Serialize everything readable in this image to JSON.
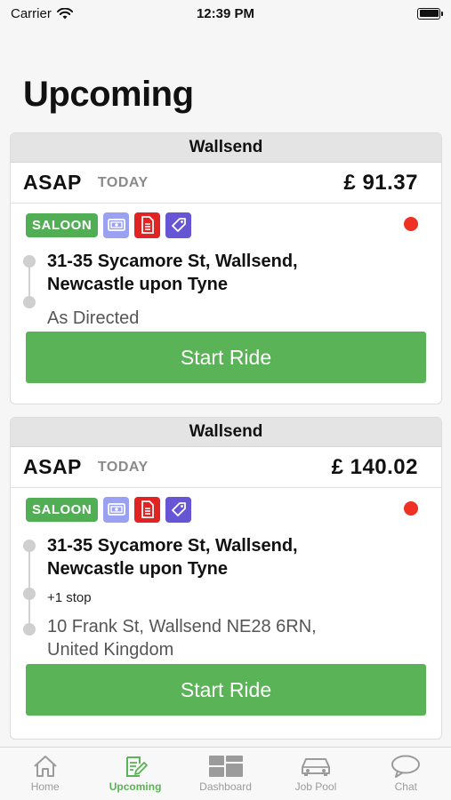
{
  "status_bar": {
    "carrier": "Carrier",
    "time": "12:39 PM"
  },
  "page": {
    "title": "Upcoming"
  },
  "rides": [
    {
      "area": "Wallsend",
      "when": "ASAP",
      "day": "TODAY",
      "price": "£ 91.37",
      "vehicle": "SALOON",
      "pickup_line1": "31-35 Sycamore St, Wallsend,",
      "pickup_line2": "Newcastle upon Tyne",
      "stops": "",
      "dropoff_line1": "As Directed",
      "dropoff_line2": "",
      "button": "Start Ride"
    },
    {
      "area": "Wallsend",
      "when": "ASAP",
      "day": "TODAY",
      "price": "£ 140.02",
      "vehicle": "SALOON",
      "pickup_line1": "31-35 Sycamore St, Wallsend,",
      "pickup_line2": "Newcastle upon Tyne",
      "stops": "+1 stop",
      "dropoff_line1": "10 Frank St, Wallsend NE28 6RN,",
      "dropoff_line2": "United Kingdom",
      "button": "Start Ride"
    }
  ],
  "tabs": [
    {
      "label": "Home",
      "icon": "home-icon"
    },
    {
      "label": "Upcoming",
      "icon": "clipboard-edit-icon",
      "active": true
    },
    {
      "label": "Dashboard",
      "icon": "dashboard-icon"
    },
    {
      "label": "Job Pool",
      "icon": "car-icon"
    },
    {
      "label": "Chat",
      "icon": "chat-bubble-icon"
    }
  ],
  "colors": {
    "accent": "#5bb357",
    "status_dot": "#ee3124",
    "cash_tag": "#9aa0f2",
    "doc_tag": "#e02424",
    "promo_tag": "#6656d6"
  }
}
